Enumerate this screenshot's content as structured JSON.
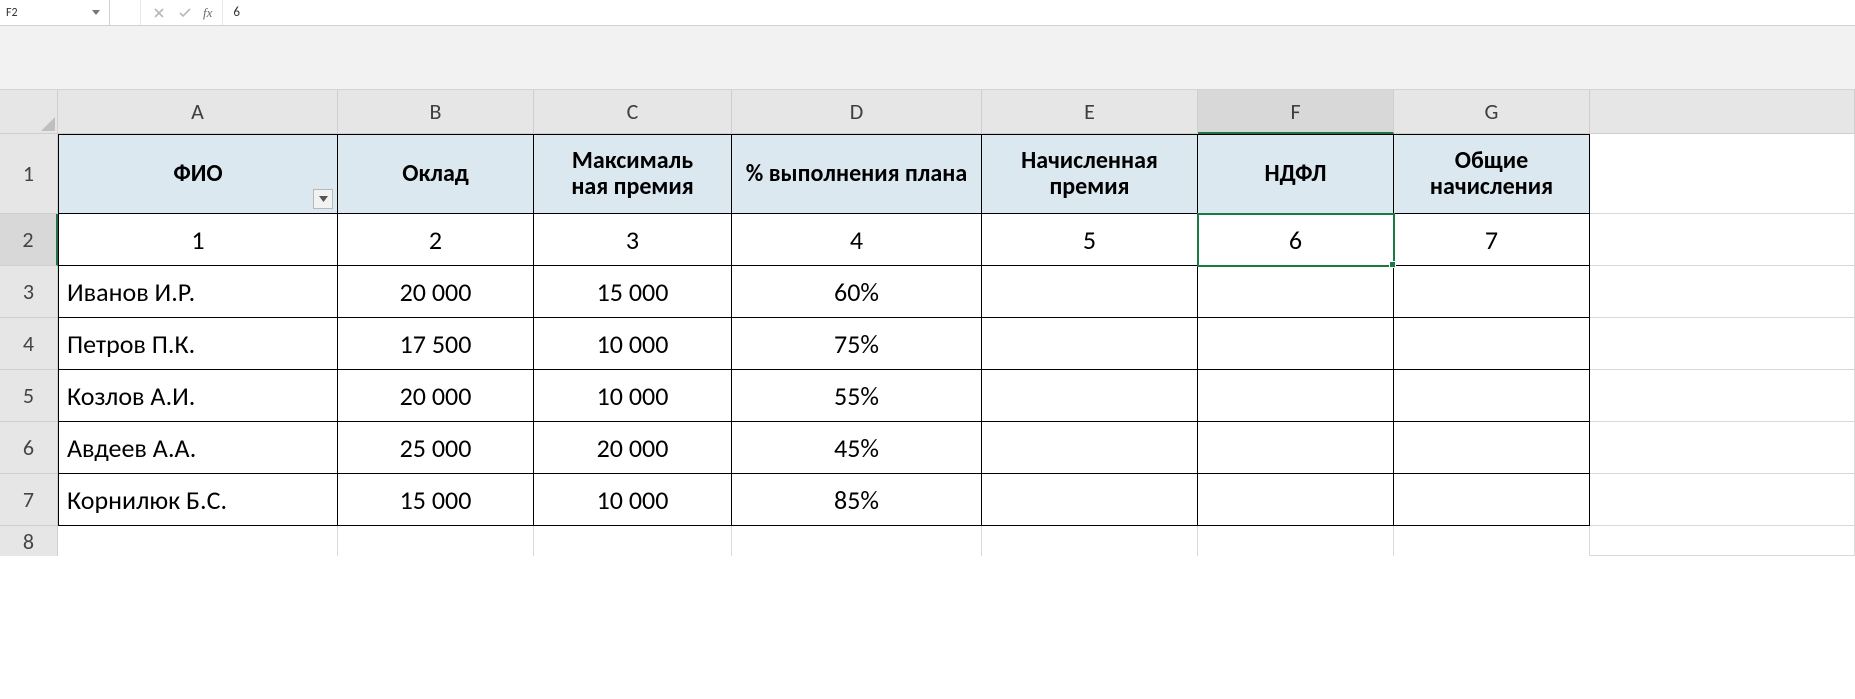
{
  "formula_bar": {
    "cell_ref": "F2",
    "fx_label": "fx",
    "value": "6"
  },
  "columns": [
    "A",
    "B",
    "C",
    "D",
    "E",
    "F",
    "G"
  ],
  "active_column": "F",
  "row_numbers": [
    "1",
    "2",
    "3",
    "4",
    "5",
    "6",
    "7",
    "8"
  ],
  "active_row": "2",
  "headers": {
    "a": "ФИО",
    "b": "Оклад",
    "c": "Максималь\nная премия",
    "d": "% выполнения плана",
    "e": "Начисленная премия",
    "f": "НДФЛ",
    "g": "Общие начисления"
  },
  "index_row": {
    "a": "1",
    "b": "2",
    "c": "3",
    "d": "4",
    "e": "5",
    "f": "6",
    "g": "7"
  },
  "rows": [
    {
      "name": "Иванов И.Р.",
      "salary": "20 000",
      "max_bonus": "15 000",
      "plan": "60%",
      "accrued": "",
      "ndfl": "",
      "total": ""
    },
    {
      "name": "Петров П.К.",
      "salary": "17 500",
      "max_bonus": "10 000",
      "plan": "75%",
      "accrued": "",
      "ndfl": "",
      "total": ""
    },
    {
      "name": "Козлов А.И.",
      "salary": "20 000",
      "max_bonus": "10 000",
      "plan": "55%",
      "accrued": "",
      "ndfl": "",
      "total": ""
    },
    {
      "name": "Авдеев А.А.",
      "salary": "25 000",
      "max_bonus": "20 000",
      "plan": "45%",
      "accrued": "",
      "ndfl": "",
      "total": ""
    },
    {
      "name": "Корнилюк Б.С.",
      "salary": "15 000",
      "max_bonus": "10 000",
      "plan": "85%",
      "accrued": "",
      "ndfl": "",
      "total": ""
    }
  ],
  "active_cell_value": "6"
}
